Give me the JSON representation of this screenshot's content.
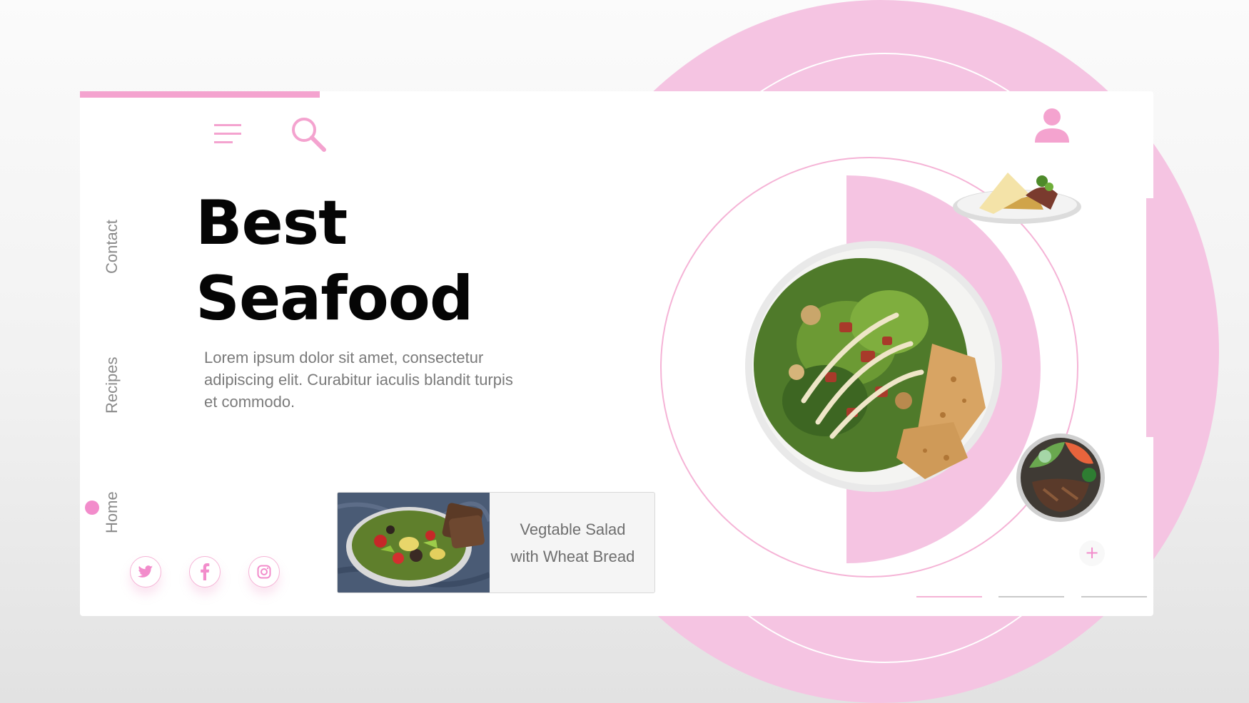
{
  "nav": {
    "items": [
      {
        "label": "Contact"
      },
      {
        "label": "Recipes"
      },
      {
        "label": "Home"
      }
    ],
    "active": "Home"
  },
  "hero": {
    "title_line1": "Best",
    "title_line2": "Seafood",
    "description": "Lorem ipsum dolor sit amet, consectetur\n adipiscing elit. Curabitur iaculis blandit turpis\net commodo."
  },
  "feature_card": {
    "label": "Vegtable Salad\nwith Wheat Bread"
  },
  "carousel": {
    "add_symbol": "+",
    "slides_total": 3,
    "active_slide": 1
  },
  "icons": {
    "menu": "menu-icon",
    "search": "search-icon",
    "user": "user-icon",
    "social": [
      "twitter-icon",
      "facebook-icon",
      "instagram-icon"
    ]
  },
  "colors": {
    "accent": "#f4a3cf",
    "accent_light": "#f5c4e2",
    "title": "#050505",
    "body_text": "#7a7a7a"
  }
}
